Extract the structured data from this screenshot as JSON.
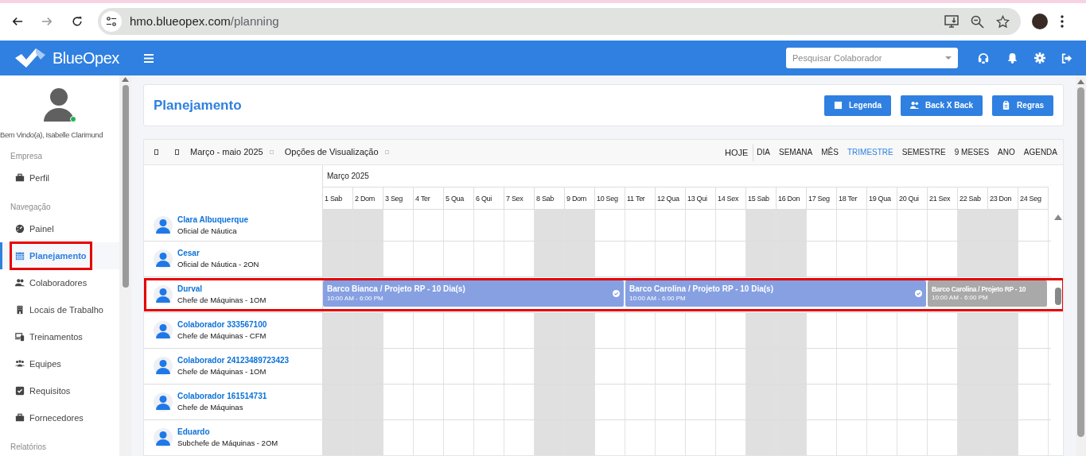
{
  "browser": {
    "url_host": "hmo.blueopex.com",
    "url_path": "/planning"
  },
  "header": {
    "brand": "BlueOpex",
    "search": {
      "placeholder": "Pesquisar Colaborador"
    }
  },
  "sidebar": {
    "greeting": "Bem Vindo(a), Isabelle Clarimund",
    "online": true,
    "sections": [
      {
        "title": "Empresa",
        "items": [
          {
            "label": "Perfil",
            "selected": false,
            "highlighted": false
          }
        ]
      },
      {
        "title": "Navegação",
        "items": [
          {
            "label": "Painel",
            "selected": false,
            "highlighted": false
          },
          {
            "label": "Planejamento",
            "selected": true,
            "highlighted": true
          },
          {
            "label": "Colaboradores",
            "selected": false,
            "highlighted": false
          },
          {
            "label": "Locais de Trabalho",
            "selected": false,
            "highlighted": false
          },
          {
            "label": "Treinamentos",
            "selected": false,
            "highlighted": false
          },
          {
            "label": "Equipes",
            "selected": false,
            "highlighted": false
          },
          {
            "label": "Requisitos",
            "selected": false,
            "highlighted": false
          },
          {
            "label": "Fornecedores",
            "selected": false,
            "highlighted": false
          }
        ]
      },
      {
        "title": "Relatórios"
      }
    ]
  },
  "page": {
    "title": "Planejamento",
    "buttons": [
      "Legenda",
      "Back X Back",
      "Regras"
    ]
  },
  "scheduler": {
    "range": "Março - maio 2025",
    "options": "Opções de Visualização",
    "today": "HOJE",
    "views": [
      {
        "label": "DIA",
        "selected": false
      },
      {
        "label": "SEMANA",
        "selected": false
      },
      {
        "label": "MÊS",
        "selected": false
      },
      {
        "label": "TRIMESTRE",
        "selected": true
      },
      {
        "label": "SEMESTRE",
        "selected": false
      },
      {
        "label": "9 MESES",
        "selected": false
      },
      {
        "label": "ANO",
        "selected": false
      },
      {
        "label": "AGENDA",
        "selected": false
      }
    ],
    "month": "Março 2025",
    "days": [
      {
        "day": "1",
        "weekday": "Sab",
        "weekend": true
      },
      {
        "day": "2",
        "weekday": "Dom",
        "weekend": true
      },
      {
        "day": "3",
        "weekday": "Seg",
        "weekend": false
      },
      {
        "day": "4",
        "weekday": "Ter",
        "weekend": false
      },
      {
        "day": "5",
        "weekday": "Qua",
        "weekend": false
      },
      {
        "day": "6",
        "weekday": "Qui",
        "weekend": false
      },
      {
        "day": "7",
        "weekday": "Sex",
        "weekend": false
      },
      {
        "day": "8",
        "weekday": "Sab",
        "weekend": true
      },
      {
        "day": "9",
        "weekday": "Dom",
        "weekend": true
      },
      {
        "day": "10",
        "weekday": "Seg",
        "weekend": false
      },
      {
        "day": "11",
        "weekday": "Ter",
        "weekend": false
      },
      {
        "day": "12",
        "weekday": "Qua",
        "weekend": false
      },
      {
        "day": "13",
        "weekday": "Qui",
        "weekend": false
      },
      {
        "day": "14",
        "weekday": "Sex",
        "weekend": false
      },
      {
        "day": "15",
        "weekday": "Sab",
        "weekend": true
      },
      {
        "day": "16",
        "weekday": "Don",
        "weekend": true
      },
      {
        "day": "17",
        "weekday": "Seg",
        "weekend": false
      },
      {
        "day": "18",
        "weekday": "Ter",
        "weekend": false
      },
      {
        "day": "19",
        "weekday": "Qua",
        "weekend": false
      },
      {
        "day": "20",
        "weekday": "Qui",
        "weekend": false
      },
      {
        "day": "21",
        "weekday": "Sex",
        "weekend": false
      },
      {
        "day": "22",
        "weekday": "Sab",
        "weekend": true
      },
      {
        "day": "23",
        "weekday": "Don",
        "weekend": true
      },
      {
        "day": "24",
        "weekday": "Seg",
        "weekend": false
      }
    ],
    "rows": [
      {
        "name": "Clara Albuquerque",
        "role": "Oficial de Náutica",
        "highlighted": false
      },
      {
        "name": "Cesar",
        "role": "Oficial de Náutica - 2ON",
        "highlighted": false
      },
      {
        "name": "Durval",
        "role": "Chefe de Máquinas - 1OM",
        "highlighted": true,
        "events": [
          {
            "title": "Barco Bianca / Projeto RP - 10 Dia(s)",
            "time": "10:00 AM - 6:00 PM",
            "confirmed": true,
            "faded": false
          },
          {
            "title": "Barco Carolina / Projeto RP - 10 Dia(s)",
            "time": "10:00 AM - 6:00 PM",
            "confirmed": true,
            "faded": false
          },
          {
            "title": "Barco Carolina / Projeto RP - 10",
            "time": "10:00 AM - 6:00 PM",
            "confirmed": false,
            "faded": true
          }
        ]
      },
      {
        "name": "Colaborador 333567100",
        "role": "Chefe de Máquinas - CFM",
        "highlighted": false
      },
      {
        "name": "Colaborador 24123489723423",
        "role": "Chefe de Máquinas - 1OM",
        "highlighted": false
      },
      {
        "name": "Colaborador 161514731",
        "role": "Chefe de Máquinas",
        "highlighted": false
      },
      {
        "name": "Eduardo",
        "role": "Subchefe de Máquinas - 2OM",
        "highlighted": false
      }
    ]
  }
}
